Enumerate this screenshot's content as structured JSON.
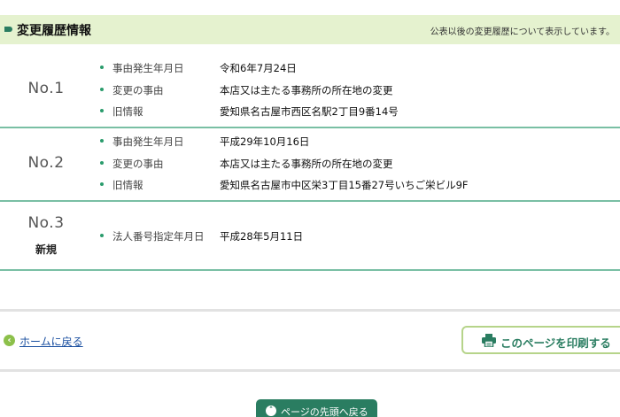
{
  "header": {
    "title": "変更履歴情報",
    "note": "公表以後の変更履歴について表示しています。"
  },
  "records": [
    {
      "no": "No.1",
      "sub": "",
      "rows": [
        {
          "label": "事由発生年月日",
          "value": "令和6年7月24日"
        },
        {
          "label": "変更の事由",
          "value": "本店又は主たる事務所の所在地の変更"
        },
        {
          "label": "旧情報",
          "value": "愛知県名古屋市西区名駅2丁目9番14号"
        }
      ]
    },
    {
      "no": "No.2",
      "sub": "",
      "rows": [
        {
          "label": "事由発生年月日",
          "value": "平成29年10月16日"
        },
        {
          "label": "変更の事由",
          "value": "本店又は主たる事務所の所在地の変更"
        },
        {
          "label": "旧情報",
          "value": "愛知県名古屋市中区栄3丁目15番27号いちご栄ビル9F"
        }
      ]
    },
    {
      "no": "No.3",
      "sub": "新規",
      "rows": [
        {
          "label": "法人番号指定年月日",
          "value": "平成28年5月11日"
        }
      ]
    }
  ],
  "footer": {
    "home_link": "ホームに戻る",
    "print_button": "このページを印刷する",
    "top_button": "ページの先頭へ戻る"
  },
  "colors": {
    "accent": "#2a7d61",
    "header_bg": "#e5f2cf",
    "link": "#1a4fa0"
  },
  "icons": {
    "home": "chevron-left-circle-icon",
    "print": "printer-icon",
    "top": "chevron-up-circle-icon"
  }
}
